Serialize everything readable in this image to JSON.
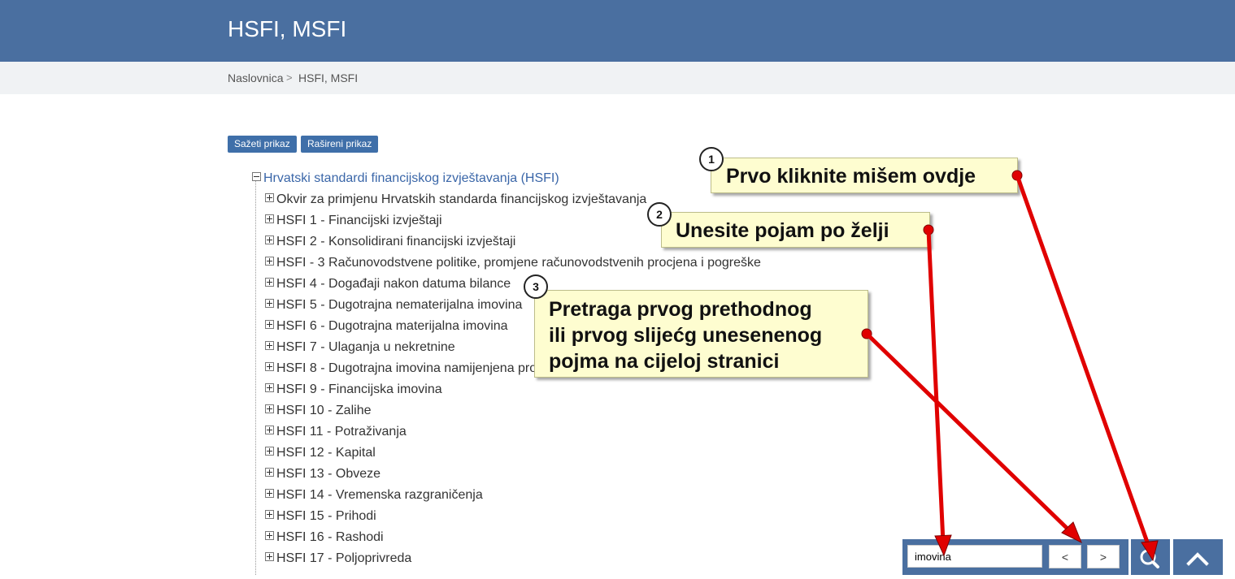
{
  "header": {
    "title": "HSFI, MSFI"
  },
  "breadcrumb": {
    "home": "Naslovnica",
    "separator": ">",
    "current": "HSFI, MSFI"
  },
  "view_buttons": {
    "collapsed": "Sažeti prikaz",
    "expanded": "Rašireni prikaz"
  },
  "tree": {
    "root": "Hrvatski standardi financijskog izvještavanja (HSFI)",
    "items": [
      "Okvir za primjenu Hrvatskih standarda financijskog izvještavanja",
      "HSFI 1 - Financijski izvještaji",
      "HSFI 2 - Konsolidirani financijski izvještaji",
      "HSFI - 3 Računovodstvene politike, promjene računovodstvenih procjena i pogreške",
      "HSFI 4 - Događaji nakon datuma bilance",
      "HSFI 5 - Dugotrajna nematerijalna imovina",
      "HSFI 6 - Dugotrajna materijalna imovina",
      "HSFI 7 - Ulaganja u nekretnine",
      "HSFI 8 - Dugotrajna imovina namijenjena prodaji i prestanak poslovanja",
      "HSFI 9 - Financijska imovina",
      "HSFI 10 - Zalihe",
      "HSFI 11 - Potraživanja",
      "HSFI 12 - Kapital",
      "HSFI 13 - Obveze",
      "HSFI 14 - Vremenska razgraničenja",
      "HSFI 15 - Prihodi",
      "HSFI 16 - Rashodi",
      "HSFI 17 - Poljoprivreda"
    ]
  },
  "callouts": [
    {
      "num": "1",
      "lines": [
        "Prvo kliknite mišem ovdje"
      ]
    },
    {
      "num": "2",
      "lines": [
        "Unesite pojam po želji"
      ]
    },
    {
      "num": "3",
      "lines": [
        "Pretraga prvog prethodnog",
        "ili prvog slijećg unesenenog",
        "pojma na cijeloj stranici"
      ]
    }
  ],
  "search": {
    "value": "imovina",
    "prev_label": "<",
    "next_label": ">"
  },
  "icons": {
    "search": "search-icon",
    "scroll_top": "chevron-up-icon"
  },
  "colors": {
    "header": "#4a6fa0",
    "button": "#3f6fa9",
    "link": "#3a66a8",
    "note": "#fefdd0",
    "arrow": "#e00000"
  }
}
